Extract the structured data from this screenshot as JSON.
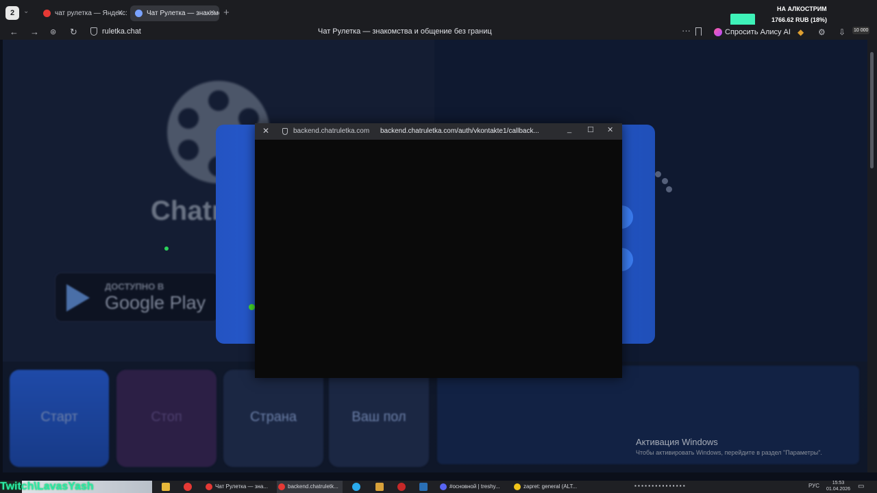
{
  "browser": {
    "profile_letter": "2",
    "tabs": [
      {
        "label": "чат рулетка — Яндекс: н",
        "favicon_color": "#e53935"
      },
      {
        "label": "Чат Рулетка — знакомс",
        "favicon_color": "#7aa2ff",
        "active": true
      }
    ],
    "url": "ruletka.chat",
    "page_title": "Чат Рулетка — знакомства и общение без границ",
    "alice_button": "Спросить Алису AI",
    "ext_counter": "10 000"
  },
  "stream_overlay": {
    "title": "НА АЛКОСТРИМ",
    "amount": "1766.62 RUB (18%)"
  },
  "site": {
    "brand_partial": "Chatr",
    "gplay_top": "ДОСТУПНО В",
    "gplay_main": "Google Play",
    "buttons": {
      "start": "Старт",
      "stop": "Стоп",
      "country": "Страна",
      "gender": "Ваш пол"
    }
  },
  "popup": {
    "host": "backend.chatruletka.com",
    "url": "backend.chatruletka.com/auth/vkontakte1/callback..."
  },
  "windows": {
    "activation_title": "Активация Windows",
    "activation_sub": "Чтобы активировать Windows, перейдите в раздел \"Параметры\"."
  },
  "taskbar": {
    "twitch_name": "Twitch\\LavasYash",
    "items": [
      {
        "label": "Чат Рулетка — зна...",
        "color": "#e53935"
      },
      {
        "label": "backend.chatruletk...",
        "color": "#e53935",
        "active": true
      },
      {
        "label": "#основной | treshy...",
        "color": "#5865f2"
      },
      {
        "label": "zapret: general (ALT...",
        "color": "#f0c419"
      }
    ],
    "lang": "РУС",
    "time": "15:53",
    "date": "01.04.2026"
  }
}
